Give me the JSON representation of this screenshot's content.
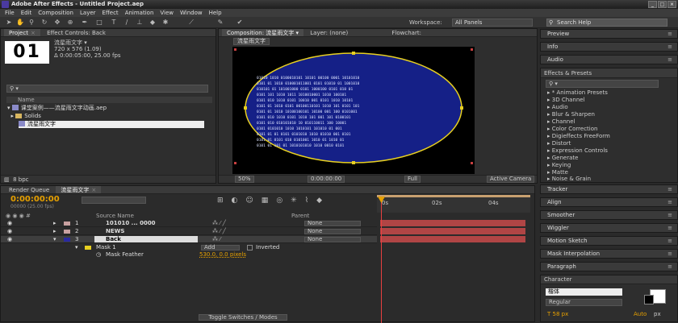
{
  "app": {
    "title": "Adobe After Effects - Untitled Project.aep"
  },
  "menu": [
    "File",
    "Edit",
    "Composition",
    "Layer",
    "Effect",
    "Animation",
    "View",
    "Window",
    "Help"
  ],
  "toolbar": {
    "workspace_label": "Workspace:",
    "workspace_value": "All Panels",
    "search_help": "Search Help"
  },
  "project_panel": {
    "tabs": [
      "Project",
      "Effect Controls: Back"
    ],
    "thumb_text": "01",
    "item_name": "流星雨文字 ▾",
    "item_info": [
      "720 x 576 (1.09)",
      "Δ 0:00:05:00, 25.00 fps"
    ],
    "search_placeholder": "⚲ ▾",
    "column_name": "Name",
    "tree": [
      "课堂案例——流星雨文字动画.aep",
      "Solids",
      "流星雨文字"
    ],
    "footer_bpc": "8 bpc"
  },
  "composition_panel": {
    "tabs": [
      "Composition: 流星雨文字 ▾",
      "Layer: (none)",
      "Flowchart:"
    ],
    "comp_tab": "流星雨文字",
    "footer": {
      "zoom": "50%",
      "timecode": "0:00:00:00",
      "resolution": "Full",
      "camera": "Active Camera"
    },
    "binary_rows": [
      "01010  1010  0100010101  10101  00100  0001  10101010",
      "0101 01   1010  010001011001  0101  01010  01  1001010",
      "010101   01  101001000  0101  1000100  0101  010  01",
      "0101 101  1010  1011  1010010001  1010  100101",
      "0101 010  1010  0101   10010 001 0101   1010 10101",
      "0101 01   1010 0101  00100110101 1010 101 0101 101",
      "0101   01  1010  10100100101 10100 001 100 0101001",
      "0101 010  1010   0101 1010  101  001 101 0100101",
      "0101 010  010101010  10 010110011  100  10001",
      "0101   0101010  1010  1010101  101010  01 001",
      "0101 01    01 0101  0101010  1010  01010 001 0101",
      "0101  01 0101 010 0101001  1010 01  1010  01",
      "0101  01 101 01  1010101010  1010  0010  0101"
    ]
  },
  "right_panels": {
    "info": "Info",
    "preview": "Preview",
    "audio": "Audio",
    "effects_tab": "Effects & Presets",
    "effects_search": "⚲ ▾",
    "effects_list": [
      "* Animation Presets",
      "3D Channel",
      "Audio",
      "Blur & Sharpen",
      "Channel",
      "Color Correction",
      "Digieffects FreeForm",
      "Distort",
      "Expression Controls",
      "Generate",
      "Keying",
      "Matte",
      "Noise & Grain"
    ],
    "tracker": "Tracker",
    "align": "Align",
    "smoother": "Smoother",
    "wiggler": "Wiggler",
    "motion_sketch": "Motion Sketch",
    "mask_interpolation": "Mask Interpolation",
    "paragraph": "Paragraph",
    "character": "Character",
    "char_font": "楷体",
    "char_style": "Regular",
    "char_size": "58 px",
    "char_auto": "Auto",
    "char_px": "px"
  },
  "timeline": {
    "tabs": [
      "Render Queue",
      "流星雨文字"
    ],
    "timecode": "0:00:00:00",
    "fps": "00000 (25.00 fps)",
    "col_source": "Source Name",
    "col_parent": "Parent",
    "layers": [
      {
        "num": "1",
        "name": "101010 ... 0000",
        "parent": "None",
        "color": "#c8a0a0"
      },
      {
        "num": "2",
        "name": "NEWS",
        "parent": "None",
        "color": "#c8a0a0"
      },
      {
        "num": "3",
        "name": "Back",
        "parent": "None",
        "color": "#2a2aa0"
      }
    ],
    "mask": {
      "name": "Mask 1",
      "mode": "Add",
      "inverted": "Inverted",
      "feather_label": "Mask Feather",
      "feather_value": "530.0, 0.0 pixels"
    },
    "toggle": "Toggle Switches / Modes",
    "ruler_labels": [
      "0s",
      "02s",
      "04s"
    ]
  }
}
